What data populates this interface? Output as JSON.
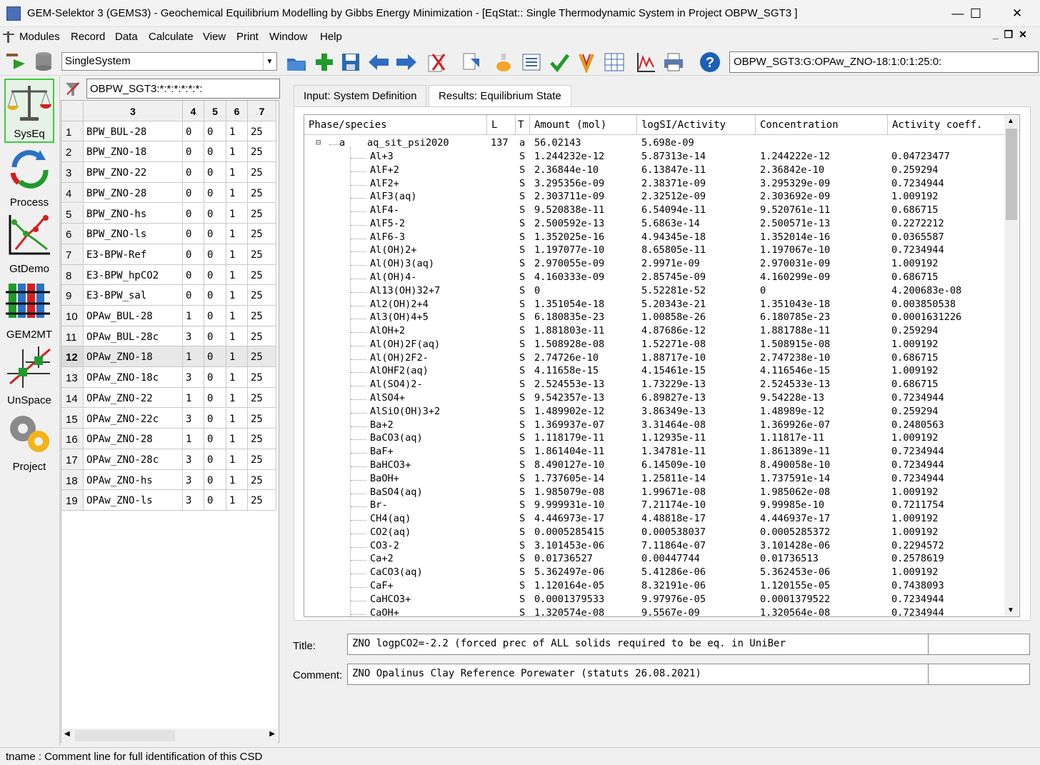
{
  "window": {
    "title": "GEM-Selektor 3 (GEMS3) - Geochemical Equilibrium Modelling by Gibbs Energy Minimization - [EqStat:: Single Thermodynamic System in Project OBPW_SGT3 ]",
    "minimize": "—",
    "maximize": "☐",
    "close": "✕"
  },
  "menu": [
    "Modules",
    "Record",
    "Data",
    "Calculate",
    "View",
    "Print",
    "Window",
    "Help"
  ],
  "mdi_controls": "_ ❐ ✕",
  "toolbar": {
    "mode_select": "SingleSystem",
    "record_path": "OBPW_SGT3:G:OPAw_ZNO-18:1:0:1:25:0:"
  },
  "sidebar": [
    {
      "label": "SysEq",
      "icon": "balance-scale-icon"
    },
    {
      "label": "Process",
      "icon": "process-cycle-icon"
    },
    {
      "label": "GtDemo",
      "icon": "graph-demo-icon"
    },
    {
      "label": "GEM2MT",
      "icon": "mass-transport-icon"
    },
    {
      "label": "UnSpace",
      "icon": "uncertainty-space-icon"
    },
    {
      "label": "Project",
      "icon": "gears-icon"
    }
  ],
  "record_filter": "OBPW_SGT3:*:*:*:*:*:*:",
  "record_list": {
    "headers": [
      "3",
      "4",
      "5",
      "6",
      "7"
    ],
    "selected_row": 12,
    "rows": [
      [
        "1",
        "BPW_BUL-28",
        "0",
        "0",
        "1",
        "25"
      ],
      [
        "2",
        "BPW_ZNO-18",
        "0",
        "0",
        "1",
        "25"
      ],
      [
        "3",
        "BPW_ZNO-22",
        "0",
        "0",
        "1",
        "25"
      ],
      [
        "4",
        "BPW_ZNO-28",
        "0",
        "0",
        "1",
        "25"
      ],
      [
        "5",
        "BPW_ZNO-hs",
        "0",
        "0",
        "1",
        "25"
      ],
      [
        "6",
        "BPW_ZNO-ls",
        "0",
        "0",
        "1",
        "25"
      ],
      [
        "7",
        "E3-BPW-Ref",
        "0",
        "0",
        "1",
        "25"
      ],
      [
        "8",
        "E3-BPW_hpCO2",
        "0",
        "0",
        "1",
        "25"
      ],
      [
        "9",
        "E3-BPW_sal",
        "0",
        "0",
        "1",
        "25"
      ],
      [
        "10",
        "OPAw_BUL-28",
        "1",
        "0",
        "1",
        "25"
      ],
      [
        "11",
        "OPAw_BUL-28c",
        "3",
        "0",
        "1",
        "25"
      ],
      [
        "12",
        "OPAw_ZNO-18",
        "1",
        "0",
        "1",
        "25"
      ],
      [
        "13",
        "OPAw_ZNO-18c",
        "3",
        "0",
        "1",
        "25"
      ],
      [
        "14",
        "OPAw_ZNO-22",
        "1",
        "0",
        "1",
        "25"
      ],
      [
        "15",
        "OPAw_ZNO-22c",
        "3",
        "0",
        "1",
        "25"
      ],
      [
        "16",
        "OPAw_ZNO-28",
        "1",
        "0",
        "1",
        "25"
      ],
      [
        "17",
        "OPAw_ZNO-28c",
        "3",
        "0",
        "1",
        "25"
      ],
      [
        "18",
        "OPAw_ZNO-hs",
        "3",
        "0",
        "1",
        "25"
      ],
      [
        "19",
        "OPAw_ZNO-ls",
        "3",
        "0",
        "1",
        "25"
      ]
    ]
  },
  "tabs": [
    "Input: System Definition",
    "Results: Equilibrium State"
  ],
  "results": {
    "columns": [
      "Phase/species",
      "L",
      "T",
      "Amount (mol)",
      "logSI/Activity",
      "Concentration",
      "Activity coeff."
    ],
    "phase": {
      "expander": "⊟",
      "type": "a",
      "name": "aq_sit_psi2020",
      "L": "137",
      "T": "a",
      "amount": "56.02143",
      "logsi": "5.698e-09"
    },
    "species": [
      [
        "Al+3",
        "S",
        "1.244232e-12",
        "5.87313e-14",
        "1.244222e-12",
        "0.04723477"
      ],
      [
        "AlF+2",
        "S",
        "2.36844e-10",
        "6.13847e-11",
        "2.36842e-10",
        "0.259294"
      ],
      [
        "AlF2+",
        "S",
        "3.295356e-09",
        "2.38371e-09",
        "3.295329e-09",
        "0.7234944"
      ],
      [
        "AlF3(aq)",
        "S",
        "2.303711e-09",
        "2.32512e-09",
        "2.303692e-09",
        "1.009192"
      ],
      [
        "AlF4-",
        "S",
        "9.520838e-11",
        "6.54094e-11",
        "9.520761e-11",
        "0.686715"
      ],
      [
        "AlF5-2",
        "S",
        "2.500592e-13",
        "5.6863e-14",
        "2.500571e-13",
        "0.2272212"
      ],
      [
        "AlF6-3",
        "S",
        "1.352025e-16",
        "4.94345e-18",
        "1.352014e-16",
        "0.0365587"
      ],
      [
        "Al(OH)2+",
        "S",
        "1.197077e-10",
        "8.65805e-11",
        "1.197067e-10",
        "0.7234944"
      ],
      [
        "Al(OH)3(aq)",
        "S",
        "2.970055e-09",
        "2.9971e-09",
        "2.970031e-09",
        "1.009192"
      ],
      [
        "Al(OH)4-",
        "S",
        "4.160333e-09",
        "2.85745e-09",
        "4.160299e-09",
        "0.686715"
      ],
      [
        "Al13(OH)32+7",
        "S",
        "0",
        "5.52281e-52",
        "0",
        "4.200683e-08"
      ],
      [
        "Al2(OH)2+4",
        "S",
        "1.351054e-18",
        "5.20343e-21",
        "1.351043e-18",
        "0.003850538"
      ],
      [
        "Al3(OH)4+5",
        "S",
        "6.180835e-23",
        "1.00858e-26",
        "6.180785e-23",
        "0.0001631226"
      ],
      [
        "AlOH+2",
        "S",
        "1.881803e-11",
        "4.87686e-12",
        "1.881788e-11",
        "0.259294"
      ],
      [
        "Al(OH)2F(aq)",
        "S",
        "1.508928e-08",
        "1.52271e-08",
        "1.508915e-08",
        "1.009192"
      ],
      [
        "Al(OH)2F2-",
        "S",
        "2.74726e-10",
        "1.88717e-10",
        "2.747238e-10",
        "0.686715"
      ],
      [
        "AlOHF2(aq)",
        "S",
        "4.11658e-15",
        "4.15461e-15",
        "4.116546e-15",
        "1.009192"
      ],
      [
        "Al(SO4)2-",
        "S",
        "2.524553e-13",
        "1.73229e-13",
        "2.524533e-13",
        "0.686715"
      ],
      [
        "AlSO4+",
        "S",
        "9.542357e-13",
        "6.89827e-13",
        "9.54228e-13",
        "0.7234944"
      ],
      [
        "AlSiO(OH)3+2",
        "S",
        "1.489902e-12",
        "3.86349e-13",
        "1.48989e-12",
        "0.259294"
      ],
      [
        "Ba+2",
        "S",
        "1.369937e-07",
        "3.31464e-08",
        "1.369926e-07",
        "0.2480563"
      ],
      [
        "BaCO3(aq)",
        "S",
        "1.118179e-11",
        "1.12935e-11",
        "1.11817e-11",
        "1.009192"
      ],
      [
        "BaF+",
        "S",
        "1.861404e-11",
        "1.34781e-11",
        "1.861389e-11",
        "0.7234944"
      ],
      [
        "BaHCO3+",
        "S",
        "8.490127e-10",
        "6.14509e-10",
        "8.490058e-10",
        "0.7234944"
      ],
      [
        "BaOH+",
        "S",
        "1.737605e-14",
        "1.25811e-14",
        "1.737591e-14",
        "0.7234944"
      ],
      [
        "BaSO4(aq)",
        "S",
        "1.985079e-08",
        "1.99671e-08",
        "1.985062e-08",
        "1.009192"
      ],
      [
        "Br-",
        "S",
        "9.999931e-10",
        "7.21174e-10",
        "9.99985e-10",
        "0.7211754"
      ],
      [
        "CH4(aq)",
        "S",
        "4.446973e-17",
        "4.48818e-17",
        "4.446937e-17",
        "1.009192"
      ],
      [
        "CO2(aq)",
        "S",
        "0.0005285415",
        "0.000538037",
        "0.0005285372",
        "1.009192"
      ],
      [
        "CO3-2",
        "S",
        "3.101453e-06",
        "7.11864e-07",
        "3.101428e-06",
        "0.2294572"
      ],
      [
        "Ca+2",
        "S",
        "0.01736527",
        "0.00447744",
        "0.01736513",
        "0.2578619"
      ],
      [
        "CaCO3(aq)",
        "S",
        "5.362497e-06",
        "5.41286e-06",
        "5.362453e-06",
        "1.009192"
      ],
      [
        "CaF+",
        "S",
        "1.120164e-05",
        "8.32191e-06",
        "1.120155e-05",
        "0.7438093"
      ],
      [
        "CaHCO3+",
        "S",
        "0.0001379533",
        "9.97976e-05",
        "0.0001379522",
        "0.7234944"
      ],
      [
        "CaOH+",
        "S",
        "1.320574e-08",
        "9.5567e-09",
        "1.320564e-08",
        "0.7234944"
      ]
    ]
  },
  "form": {
    "title_label": "Title:",
    "title_value": "ZNO logpCO2=-2.2 (forced prec of ALL solids required to be eq. in UniBer",
    "comment_label": "Comment:",
    "comment_value": "ZNO Opalinus Clay Reference Porewater (statuts 26.08.2021)"
  },
  "status": "tname : Comment line for full identification of this CSD"
}
